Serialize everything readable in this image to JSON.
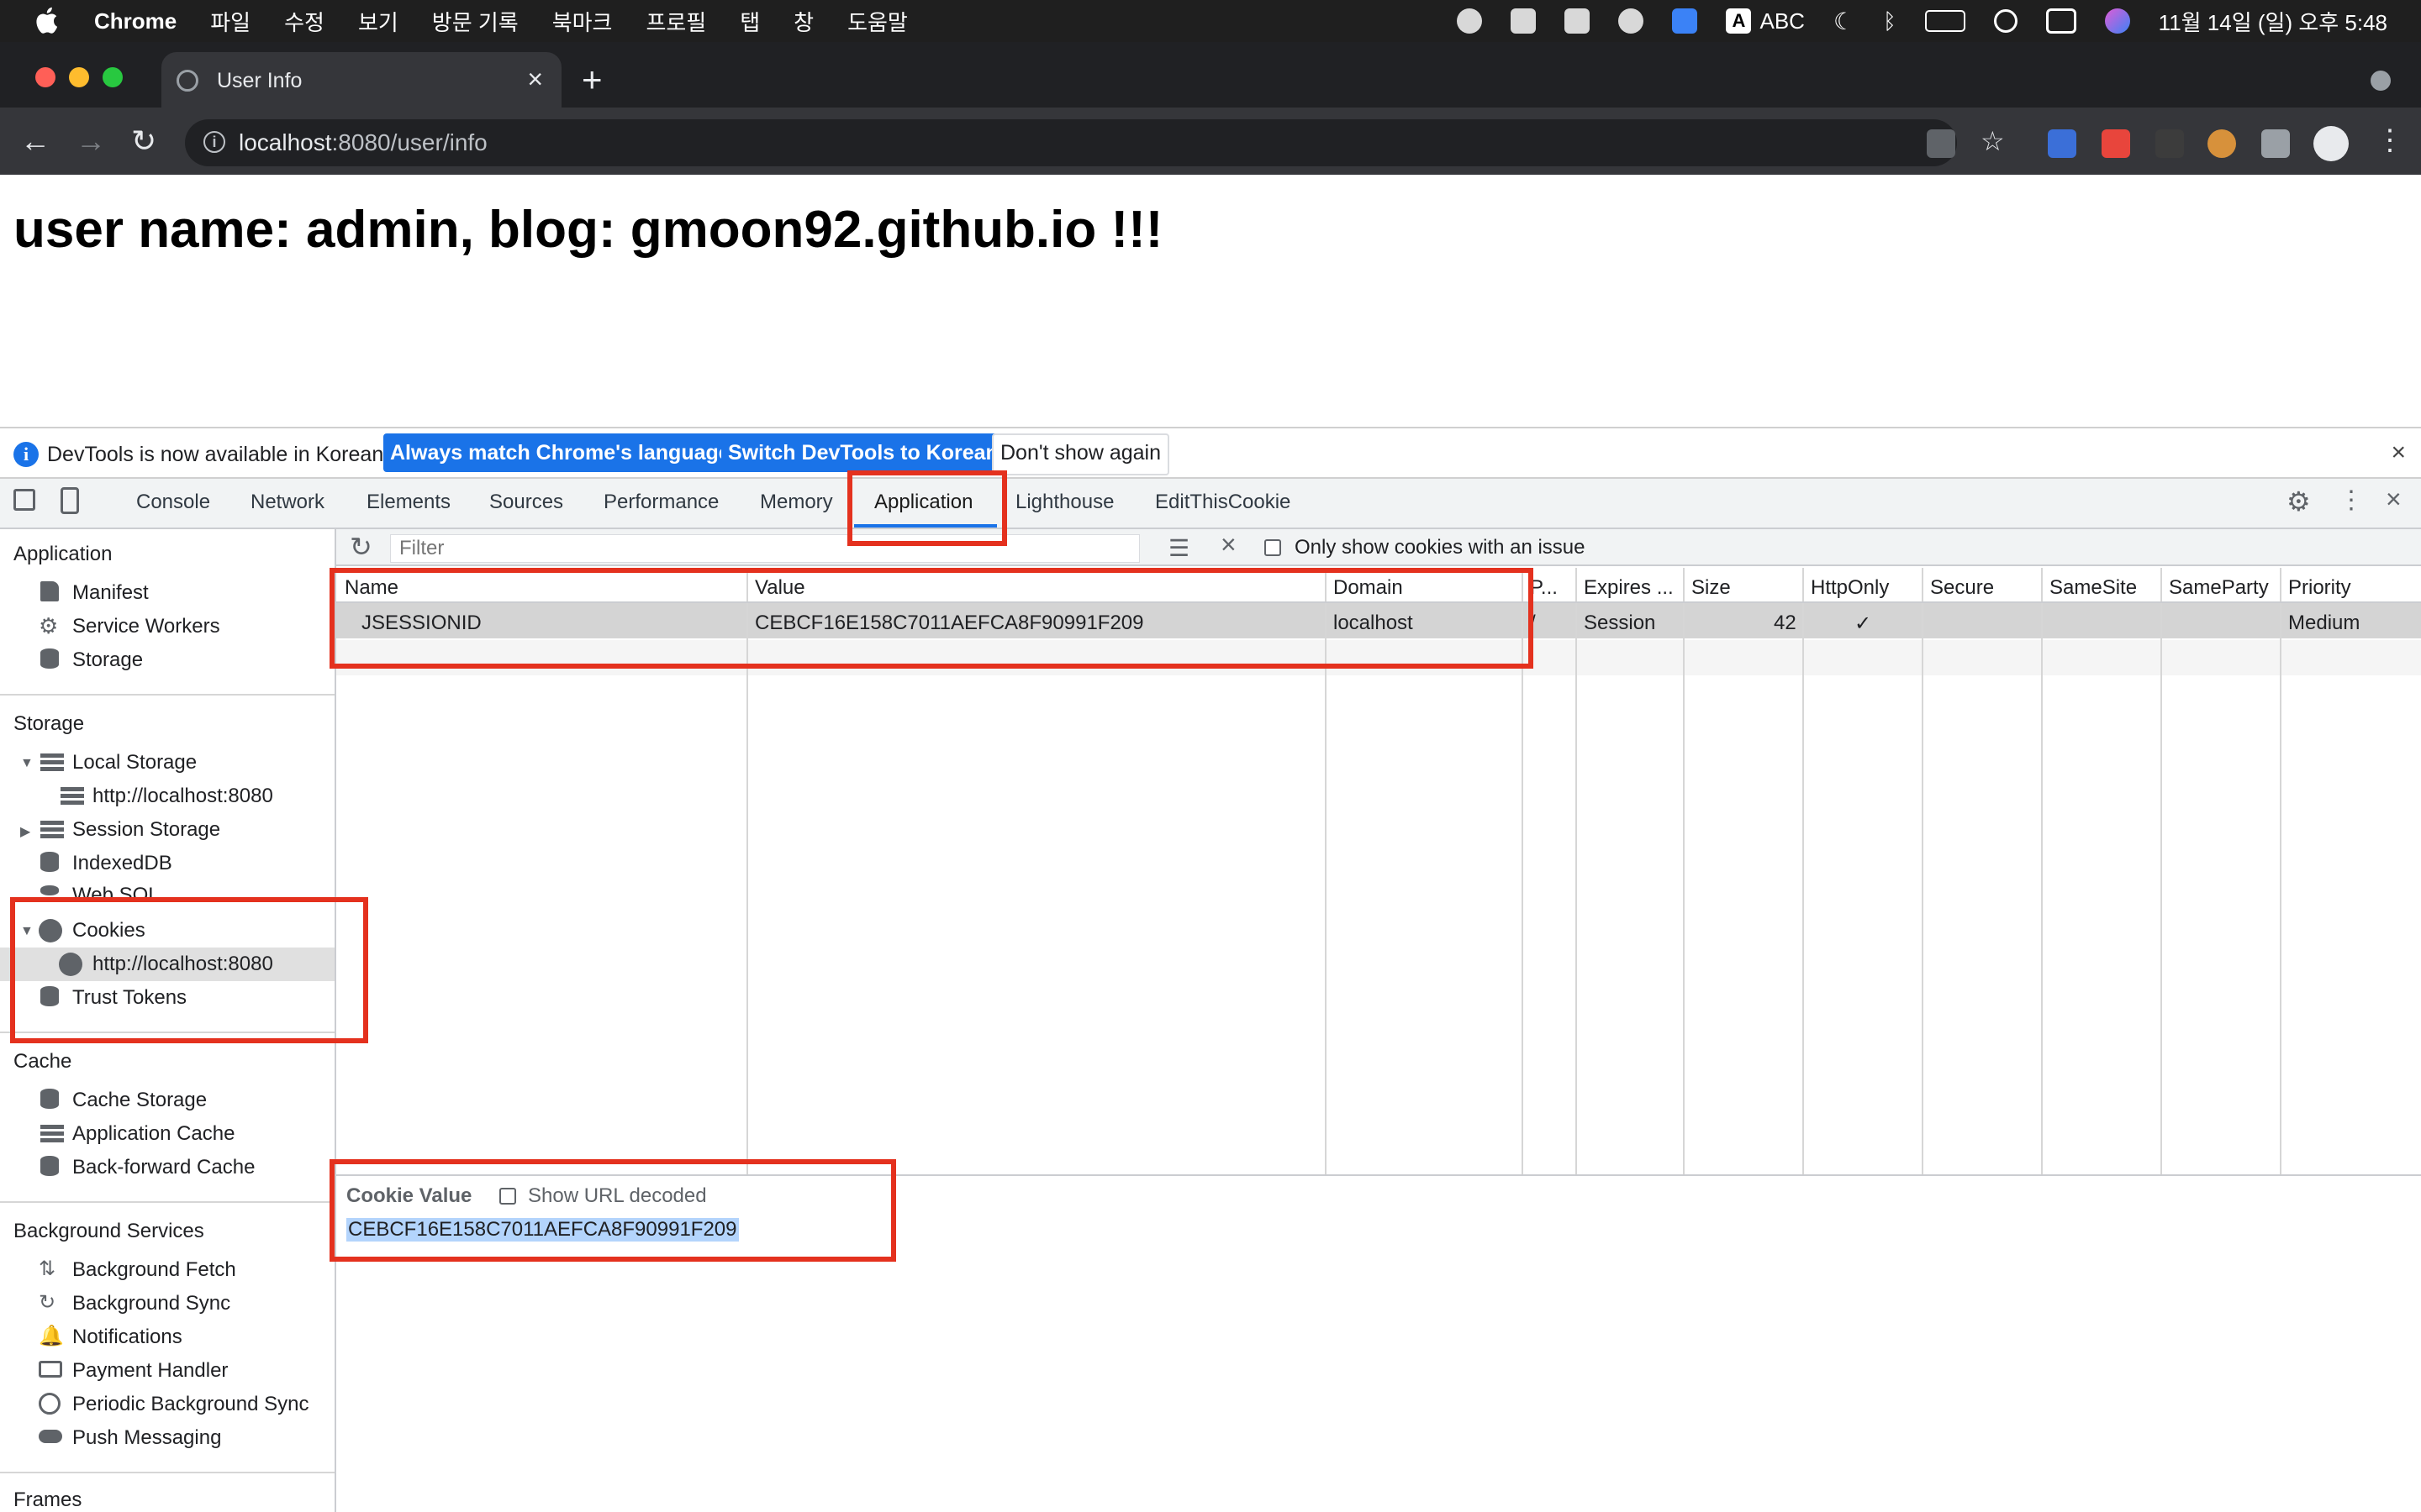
{
  "menubar": {
    "app_name": "Chrome",
    "items": [
      "파일",
      "수정",
      "보기",
      "방문 기록",
      "북마크",
      "프로필",
      "탭",
      "창",
      "도움말"
    ],
    "input_source": "ABC",
    "datetime": "11월 14일 (일) 오후 5:48"
  },
  "browser": {
    "tab_title": "User Info",
    "url_host": "localhost",
    "url_path": ":8080/user/info"
  },
  "page": {
    "heading": "user name: admin, blog: gmoon92.github.io !!!"
  },
  "infobar": {
    "message": "DevTools is now available in Korean!",
    "btn_match": "Always match Chrome's language",
    "btn_switch": "Switch DevTools to Korean",
    "btn_dismiss": "Don't show again"
  },
  "devtools": {
    "tabs": [
      "Console",
      "Network",
      "Elements",
      "Sources",
      "Performance",
      "Memory",
      "Application",
      "Lighthouse",
      "EditThisCookie"
    ],
    "active_tab": "Application"
  },
  "sidebar": {
    "application_header": "Application",
    "application_items": [
      "Manifest",
      "Service Workers",
      "Storage"
    ],
    "storage_header": "Storage",
    "local_storage": "Local Storage",
    "local_storage_child": "http://localhost:8080",
    "session_storage": "Session Storage",
    "indexeddb": "IndexedDB",
    "websql": "Web SQL",
    "cookies": "Cookies",
    "cookies_child": "http://localhost:8080",
    "trust_tokens": "Trust Tokens",
    "cache_header": "Cache",
    "cache_items": [
      "Cache Storage",
      "Application Cache",
      "Back-forward Cache"
    ],
    "bg_header": "Background Services",
    "bg_items": [
      "Background Fetch",
      "Background Sync",
      "Notifications",
      "Payment Handler",
      "Periodic Background Sync",
      "Push Messaging"
    ],
    "frames_header": "Frames"
  },
  "cookies_toolbar": {
    "filter_placeholder": "Filter",
    "only_issue_label": "Only show cookies with an issue"
  },
  "table": {
    "headers": [
      "Name",
      "Value",
      "Domain",
      "P...",
      "Expires ...",
      "Size",
      "HttpOnly",
      "Secure",
      "SameSite",
      "SameParty",
      "Priority"
    ],
    "rows": [
      {
        "name": "JSESSIONID",
        "value": "CEBCF16E158C7011AEFCA8F90991F209",
        "domain": "localhost",
        "path": "/",
        "expires": "Session",
        "size": "42",
        "httponly": "✓",
        "priority": "Medium"
      }
    ]
  },
  "cookie_value_pane": {
    "label": "Cookie Value",
    "decode_label": "Show URL decoded",
    "value": "CEBCF16E158C7011AEFCA8F90991F209"
  },
  "colors": {
    "highlight_box": "#e4311e",
    "accent": "#1a73e8"
  }
}
